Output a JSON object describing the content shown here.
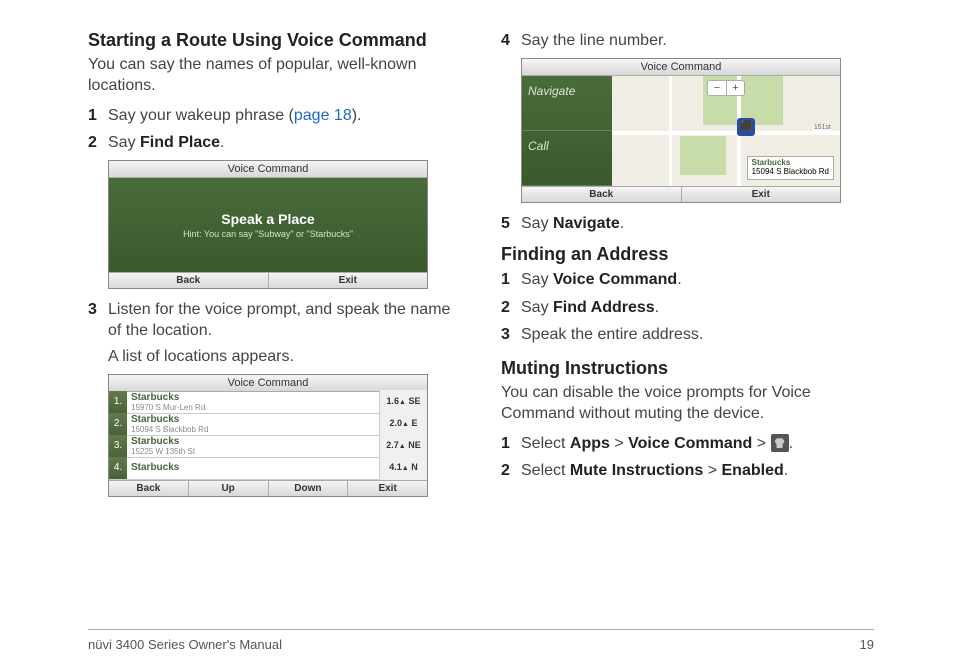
{
  "col1": {
    "heading": "Starting a Route Using Voice Command",
    "intro": "You can say the names of popular, well-known locations.",
    "steps": {
      "s1_num": "1",
      "s1_a": "Say your wakeup phrase (",
      "s1_link": "page 18",
      "s1_b": ").",
      "s2_num": "2",
      "s2_a": "Say ",
      "s2_bold": "Find Place",
      "s2_b": ".",
      "s3_num": "3",
      "s3": "Listen for the voice prompt, and speak the name of the location.",
      "s3_sub": "A list of locations appears."
    },
    "scr1": {
      "title": "Voice Command",
      "speak": "Speak a Place",
      "hint": "Hint: You can say \"Subway\" or \"Starbucks\"",
      "back": "Back",
      "exit": "Exit"
    },
    "scr2": {
      "title": "Voice Command",
      "rows": [
        {
          "n": "1.",
          "name": "Starbucks",
          "addr": "15970 S Mur-Len Rd",
          "dist": "1.6",
          "dir": "SE"
        },
        {
          "n": "2.",
          "name": "Starbucks",
          "addr": "15094 S Blackbob Rd",
          "dist": "2.0",
          "dir": "E"
        },
        {
          "n": "3.",
          "name": "Starbucks",
          "addr": "15225 W 135th St",
          "dist": "2.7",
          "dir": "NE"
        },
        {
          "n": "4.",
          "name": "Starbucks",
          "addr": "",
          "dist": "4.1",
          "dir": "N"
        }
      ],
      "back": "Back",
      "up": "Up",
      "down": "Down",
      "exit": "Exit"
    }
  },
  "col2": {
    "s4_num": "4",
    "s4": "Say the line number.",
    "scr3": {
      "title": "Voice Command",
      "navigate": "Navigate",
      "call": "Call",
      "minus": "−",
      "plus": "+",
      "street": "151st",
      "loc_name": "Starbucks",
      "loc_addr": "15094 S Blackbob Rd",
      "back": "Back",
      "exit": "Exit"
    },
    "s5_num": "5",
    "s5_a": "Say ",
    "s5_bold": "Navigate",
    "s5_b": ".",
    "sec2_heading": "Finding an Address",
    "sec2": {
      "s1_num": "1",
      "s1_a": "Say ",
      "s1_bold": "Voice Command",
      "s1_b": ".",
      "s2_num": "2",
      "s2_a": "Say ",
      "s2_bold": "Find Address",
      "s2_b": ".",
      "s3_num": "3",
      "s3": "Speak the entire address."
    },
    "sec3_heading": "Muting Instructions",
    "sec3_intro": "You can disable the voice prompts for Voice Command without muting the device.",
    "sec3": {
      "s1_num": "1",
      "s1_a": "Select ",
      "s1_b1": "Apps",
      "s1_gt1": " > ",
      "s1_b2": "Voice Command",
      "s1_gt2": " > ",
      "s1_end": ".",
      "s2_num": "2",
      "s2_a": "Select ",
      "s2_b1": "Mute Instructions",
      "s2_gt": " > ",
      "s2_b2": "Enabled",
      "s2_end": "."
    }
  },
  "footer": {
    "manual": "nüvi 3400 Series Owner's Manual",
    "page": "19"
  }
}
